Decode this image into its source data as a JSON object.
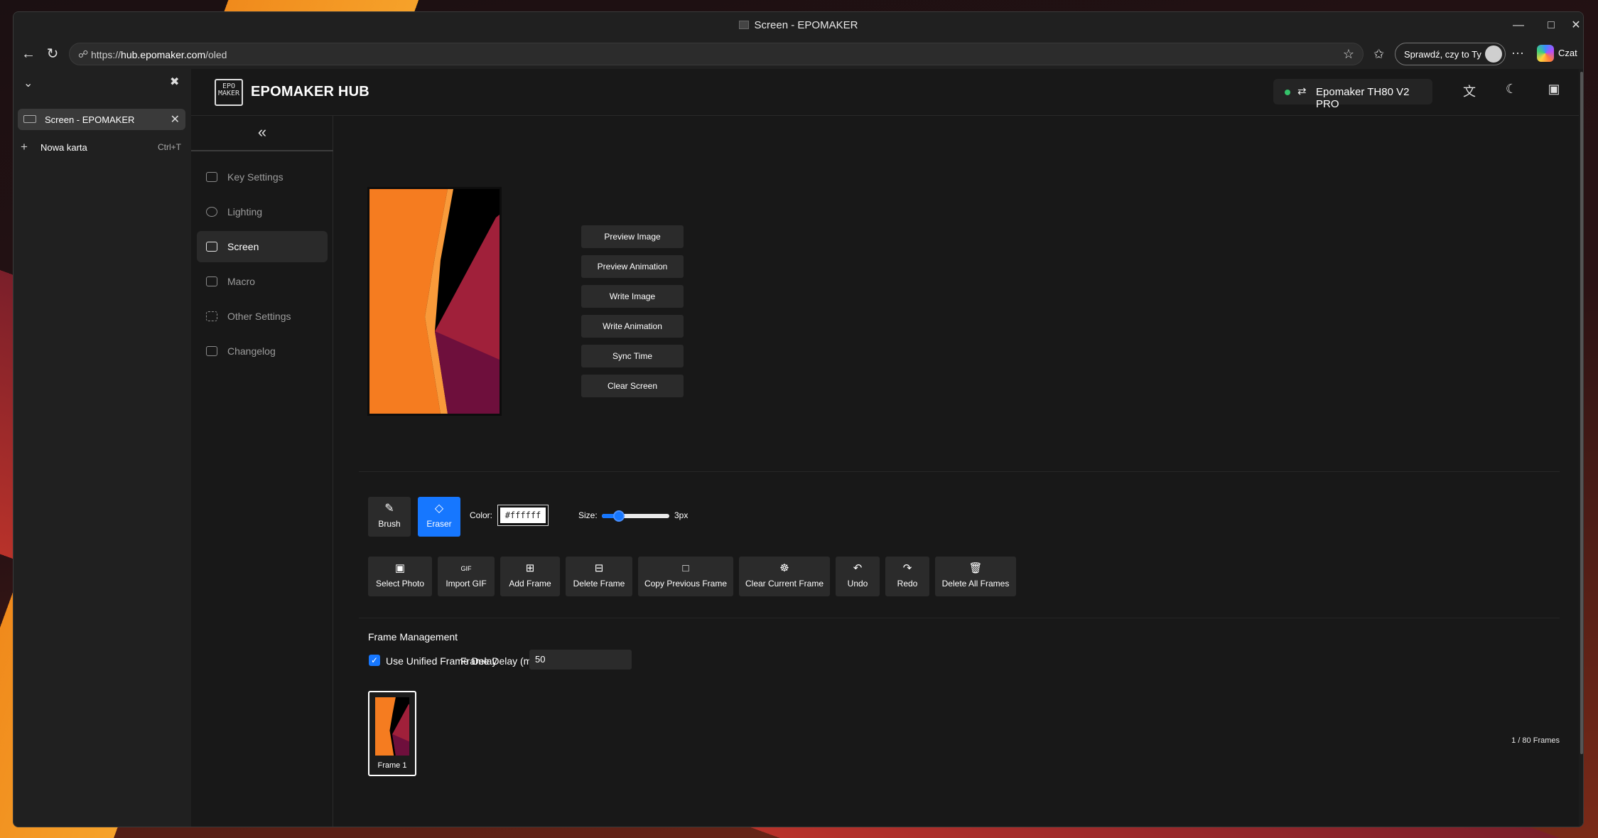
{
  "window": {
    "title": "Screen - EPOMAKER"
  },
  "browser": {
    "url_prefix": "https://",
    "url_host": "hub.epomaker.com",
    "url_path": "/oled",
    "profile_label": "Sprawdź, czy to Ty",
    "copilot_label": "Czat"
  },
  "tabs": {
    "active_label": "Screen - EPOMAKER",
    "new_tab_label": "Nowa karta",
    "new_tab_shortcut": "Ctrl+T"
  },
  "app": {
    "logo_text": "EPOM AKER",
    "brand": "EPOMAKER HUB",
    "device_name": "Epomaker TH80 V2 PRO",
    "device_status_color": "#35c26a"
  },
  "sidebar": {
    "items": [
      {
        "label": "Key Settings",
        "icon": "keyboard-icon"
      },
      {
        "label": "Lighting",
        "icon": "bulb-icon"
      },
      {
        "label": "Screen",
        "icon": "monitor-icon"
      },
      {
        "label": "Macro",
        "icon": "image-icon"
      },
      {
        "label": "Other Settings",
        "icon": "grid-icon"
      },
      {
        "label": "Changelog",
        "icon": "document-icon"
      }
    ],
    "active": "Screen"
  },
  "actions": {
    "preview_image": "Preview Image",
    "preview_animation": "Preview Animation",
    "write_image": "Write Image",
    "write_animation": "Write Animation",
    "sync_time": "Sync Time",
    "clear_screen": "Clear Screen"
  },
  "tools": {
    "brush": "Brush",
    "eraser": "Eraser",
    "active_tool": "Eraser",
    "color_label": "Color:",
    "color_value": "#ffffff",
    "size_label": "Size:",
    "size_value": "3px",
    "size_fraction": 0.25
  },
  "frame_tools": {
    "select_photo": "Select Photo",
    "import_gif": "Import GIF",
    "add_frame": "Add Frame",
    "delete_frame": "Delete Frame",
    "copy_previous": "Copy Previous Frame",
    "clear_current": "Clear Current Frame",
    "undo": "Undo",
    "redo": "Redo",
    "delete_all": "Delete All Frames"
  },
  "frame_management": {
    "title": "Frame Management",
    "unified_label": "Use Unified Frame Delay",
    "unified_checked": true,
    "delay_label": "Frame Delay (ms):",
    "delay_value": "50",
    "frames": [
      {
        "label": "Frame 1"
      }
    ],
    "count_text": "1 / 80 Frames"
  },
  "colors": {
    "accent": "#1677ff",
    "preview_orange": "#f57c20",
    "preview_magenta": "#8a1a4a"
  }
}
